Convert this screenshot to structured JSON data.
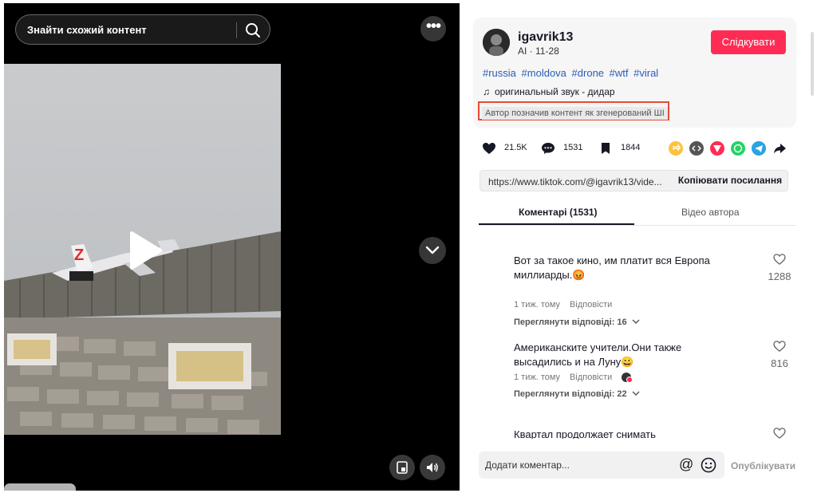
{
  "video": {
    "search_placeholder": "Знайти схожий контент",
    "more_label": "•••",
    "frame_marker": "Z"
  },
  "author": {
    "username": "igavrik13",
    "subline": "AI · 11-28",
    "follow_label": "Слідкувати"
  },
  "hashtags": [
    "#russia",
    "#moldova",
    "#drone",
    "#wtf",
    "#viral"
  ],
  "sound": {
    "label": "оригинальный звук - дидар"
  },
  "ai_label": "Автор позначив контент як згенерований ШІ",
  "stats": {
    "likes": "21.5K",
    "comments": "1531",
    "saves": "1844"
  },
  "share_icons": [
    "repost-icon",
    "embed-icon",
    "send-icon",
    "whatsapp-icon",
    "telegram-icon",
    "share-arrow-icon"
  ],
  "share_colors": {
    "repost": "#fdc13f",
    "embed": "#555555",
    "send": "#fe2c55",
    "whatsapp": "#25d366",
    "telegram": "#2aa3e0"
  },
  "link": {
    "url": "https://www.tiktok.com/@igavrik13/vide...",
    "copy_label": "Копіювати посилання"
  },
  "tabs": {
    "comments": "Коментарі (1531)",
    "author_videos": "Відео автора"
  },
  "comments": [
    {
      "text": "Вот за такое кино, им платит вся Европа миллиарды.😡",
      "time": "1 тиж. тому",
      "reply": "Відповісти",
      "view_replies": "Переглянути відповіді: 16",
      "likes": "1288"
    },
    {
      "text": "Американските учители.Они также высадились и на Луну😀",
      "time": "1 тиж. тому",
      "reply": "Відповісти",
      "view_replies": "Переглянути відповіді: 22",
      "likes": "816"
    },
    {
      "text": "Квартал продолжает снимать юмористичный",
      "time": "",
      "reply": "",
      "view_replies": "",
      "likes": ""
    }
  ],
  "comment_input": {
    "placeholder": "Додати коментар...",
    "at": "@",
    "publish_label": "Опублікувати"
  },
  "brand_colors": {
    "accent": "#fe2c55",
    "hashtag": "#2b5db5",
    "highlight_border": "#e84a3a"
  }
}
